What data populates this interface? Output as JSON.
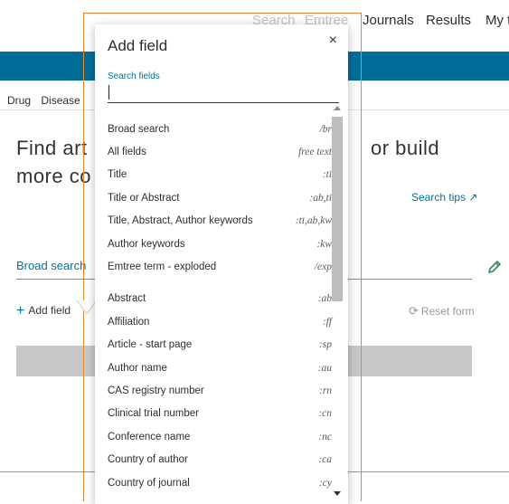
{
  "topnav": {
    "items": [
      "Search",
      "Emtree",
      "Journals",
      "Results",
      "My t"
    ]
  },
  "tabs": {
    "items": [
      "Drug",
      "Disease"
    ]
  },
  "heading": {
    "line1_left": "Find art",
    "line1_right": "or build",
    "line2_left": "more co"
  },
  "search_tips": "Search tips ↗",
  "broad_search_label": "Broad search",
  "add_field_label": "Add field",
  "reset_form_label": "Reset form",
  "popover": {
    "title": "Add field",
    "close_glyph": "×",
    "search_label": "Search fields",
    "search_value": "",
    "group1": [
      {
        "label": "Broad search",
        "code": "/br"
      },
      {
        "label": "All fields",
        "code": "free text"
      },
      {
        "label": "Title",
        "code": ":ti"
      },
      {
        "label": "Title or Abstract",
        "code": ":ab,ti"
      },
      {
        "label": "Title, Abstract, Author keywords",
        "code": ":ti,ab,kw"
      },
      {
        "label": "Author keywords",
        "code": ":kw"
      },
      {
        "label": "Emtree term - exploded",
        "code": "/exp"
      }
    ],
    "group2": [
      {
        "label": "Abstract",
        "code": ":ab"
      },
      {
        "label": "Affiliation",
        "code": ":ff"
      },
      {
        "label": "Article - start page",
        "code": ":sp"
      },
      {
        "label": "Author name",
        "code": ":au"
      },
      {
        "label": "CAS registry number",
        "code": ":rn"
      },
      {
        "label": "Clinical trial number",
        "code": ":cn"
      },
      {
        "label": "Conference name",
        "code": ":nc"
      },
      {
        "label": "Country of author",
        "code": ":ca"
      },
      {
        "label": "Country of journal",
        "code": ":cy"
      }
    ]
  },
  "colors": {
    "brand_blue": "#006d99",
    "link_teal": "#007398",
    "focus_orange": "#e6862e"
  }
}
